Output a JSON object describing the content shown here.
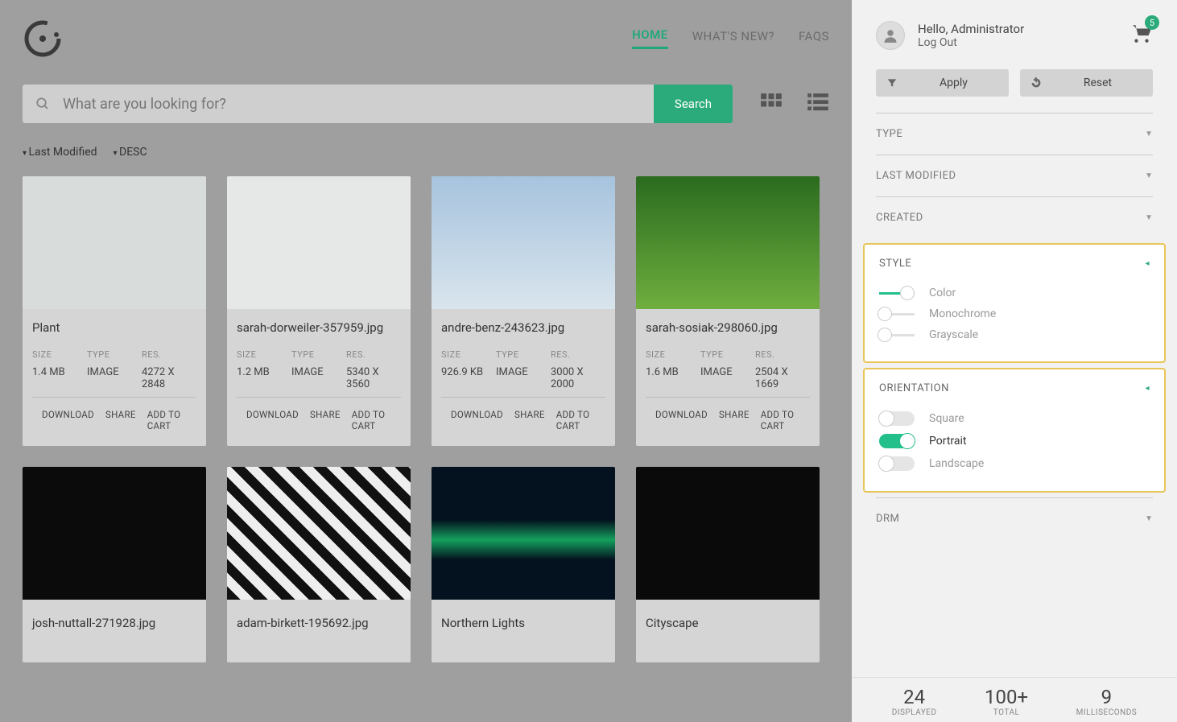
{
  "nav": {
    "home": "HOME",
    "whatsnew": "WHAT'S NEW?",
    "faqs": "FAQS"
  },
  "search": {
    "placeholder": "What are you looking for?",
    "button": "Search"
  },
  "sort": {
    "field": "Last Modified",
    "dir": "DESC"
  },
  "meta_labels": {
    "size": "SIZE",
    "type": "TYPE",
    "res": "RES."
  },
  "actions": {
    "download": "DOWNLOAD",
    "share": "SHARE",
    "add": "ADD TO CART"
  },
  "cards": [
    {
      "title": "Plant",
      "size": "1.4 MB",
      "type": "IMAGE",
      "res": "4272 X 2848",
      "img": "img1"
    },
    {
      "title": "sarah-dorweiler-357959.jpg",
      "size": "1.2 MB",
      "type": "IMAGE",
      "res": "5340 X 3560",
      "img": "img2"
    },
    {
      "title": "andre-benz-243623.jpg",
      "size": "926.9 KB",
      "type": "IMAGE",
      "res": "3000 X 2000",
      "img": "img3"
    },
    {
      "title": "sarah-sosiak-298060.jpg",
      "size": "1.6 MB",
      "type": "IMAGE",
      "res": "2504 X 1669",
      "img": "img4"
    },
    {
      "title": "josh-nuttall-271928.jpg",
      "img": "img5"
    },
    {
      "title": "adam-birkett-195692.jpg",
      "img": "img6"
    },
    {
      "title": "Northern Lights",
      "img": "img7"
    },
    {
      "title": "Cityscape",
      "img": "img8"
    }
  ],
  "panel": {
    "greeting": "Hello, Administrator",
    "logout": "Log Out",
    "cart_count": "5",
    "apply": "Apply",
    "reset": "Reset",
    "filters": {
      "type": "TYPE",
      "last_modified": "LAST MODIFIED",
      "created": "CREATED",
      "drm": "DRM"
    },
    "style": {
      "title": "STYLE",
      "options": [
        {
          "label": "Color",
          "on": true
        },
        {
          "label": "Monochrome",
          "on": false
        },
        {
          "label": "Grayscale",
          "on": false
        }
      ]
    },
    "orientation": {
      "title": "ORIENTATION",
      "options": [
        {
          "label": "Square",
          "on": false
        },
        {
          "label": "Portrait",
          "on": true
        },
        {
          "label": "Landscape",
          "on": false
        }
      ]
    }
  },
  "stats": {
    "displayed": {
      "num": "24",
      "lbl": "DISPLAYED"
    },
    "total": {
      "num": "100+",
      "lbl": "TOTAL"
    },
    "ms": {
      "num": "9",
      "lbl": "MILLISECONDS"
    }
  }
}
